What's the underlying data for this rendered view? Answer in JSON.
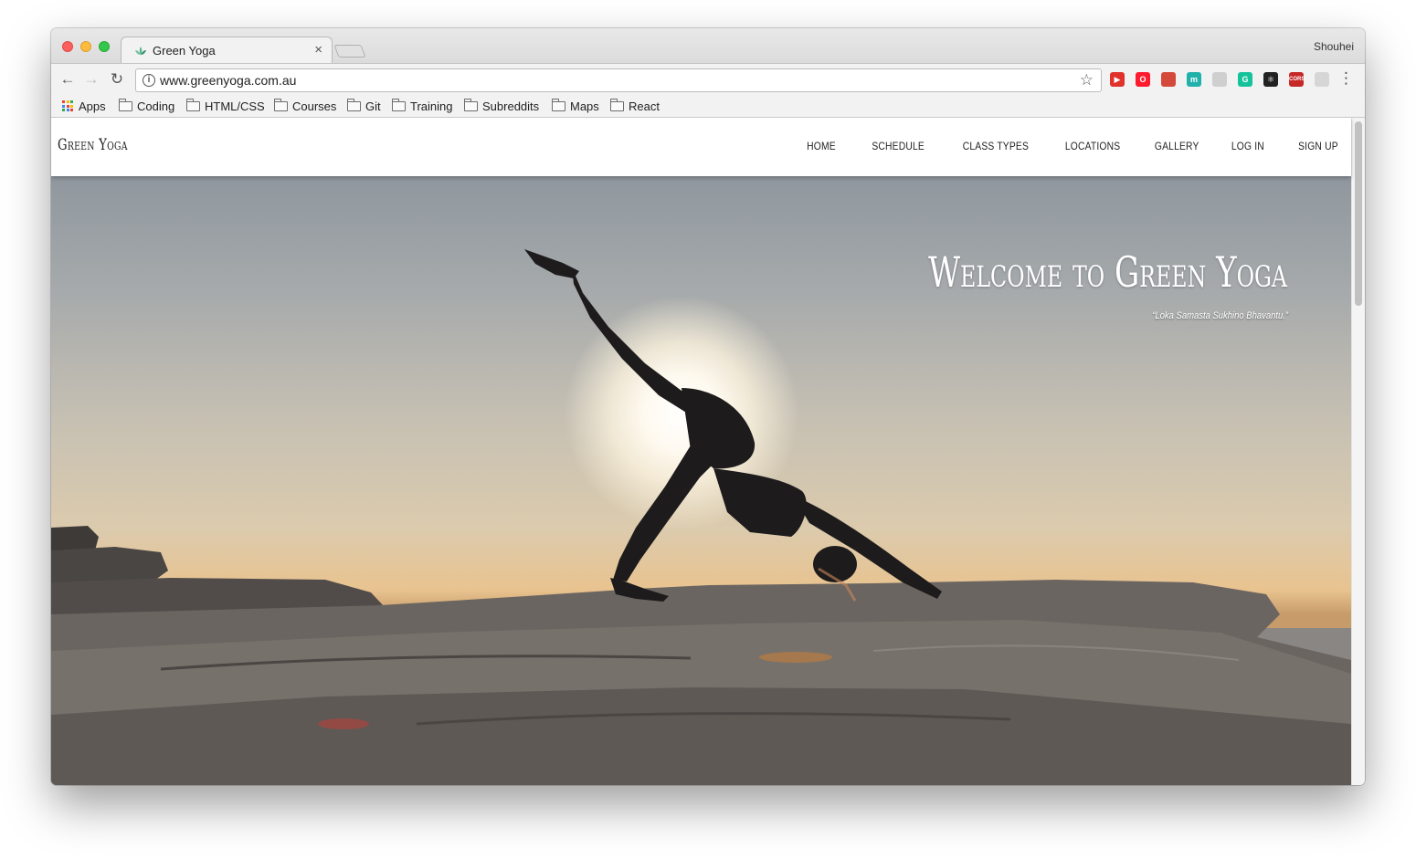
{
  "browser": {
    "tab_title": "Green Yoga",
    "tab_close": "×",
    "profile_name": "Shouhei",
    "url": "www.greenyoga.com.au",
    "nav": {
      "back": "←",
      "forward": "→",
      "reload": "↻",
      "star": "☆",
      "menu": "⋮",
      "info": "i"
    },
    "extensions": [
      {
        "name": "extension-1",
        "color": "#e0322b",
        "glyph": "▶"
      },
      {
        "name": "extension-2",
        "color": "#ff1b2d",
        "glyph": "O"
      },
      {
        "name": "extension-3",
        "color": "#d44a3a",
        "glyph": ""
      },
      {
        "name": "extension-4",
        "color": "#20b2aa",
        "glyph": "m"
      },
      {
        "name": "extension-5",
        "color": "#cfcfcf",
        "glyph": ""
      },
      {
        "name": "extension-6",
        "color": "#15c39a",
        "glyph": "G"
      },
      {
        "name": "extension-7",
        "color": "#222222",
        "glyph": "⚛"
      },
      {
        "name": "extension-8",
        "color": "#c62828",
        "glyph": "CORS"
      },
      {
        "name": "extension-9",
        "color": "#d6d6d6",
        "glyph": ""
      }
    ]
  },
  "bookmarks": [
    {
      "label": "Apps",
      "type": "apps"
    },
    {
      "label": "Coding",
      "type": "folder"
    },
    {
      "label": "HTML/CSS",
      "type": "folder"
    },
    {
      "label": "Courses",
      "type": "folder"
    },
    {
      "label": "Git",
      "type": "folder"
    },
    {
      "label": "Training",
      "type": "folder"
    },
    {
      "label": "Subreddits",
      "type": "folder"
    },
    {
      "label": "Maps",
      "type": "folder"
    },
    {
      "label": "React",
      "type": "folder"
    }
  ],
  "site": {
    "brand": "Green Yoga",
    "nav_links": [
      "HOME",
      "SCHEDULE",
      "CLASS TYPES",
      "LOCATIONS",
      "GALLERY",
      "LOG IN",
      "SIGN UP"
    ],
    "hero_title": "Welcome to Green Yoga",
    "hero_quote": "“Loka Samasta Sukhino Bhavantu.”"
  },
  "colors": {
    "accent": "#4caf89",
    "apps_grid": [
      "#ea4335",
      "#fbbc05",
      "#34a853",
      "#4285f4",
      "#ea4335",
      "#fbbc05",
      "#34a853",
      "#4285f4",
      "#ea4335"
    ]
  }
}
